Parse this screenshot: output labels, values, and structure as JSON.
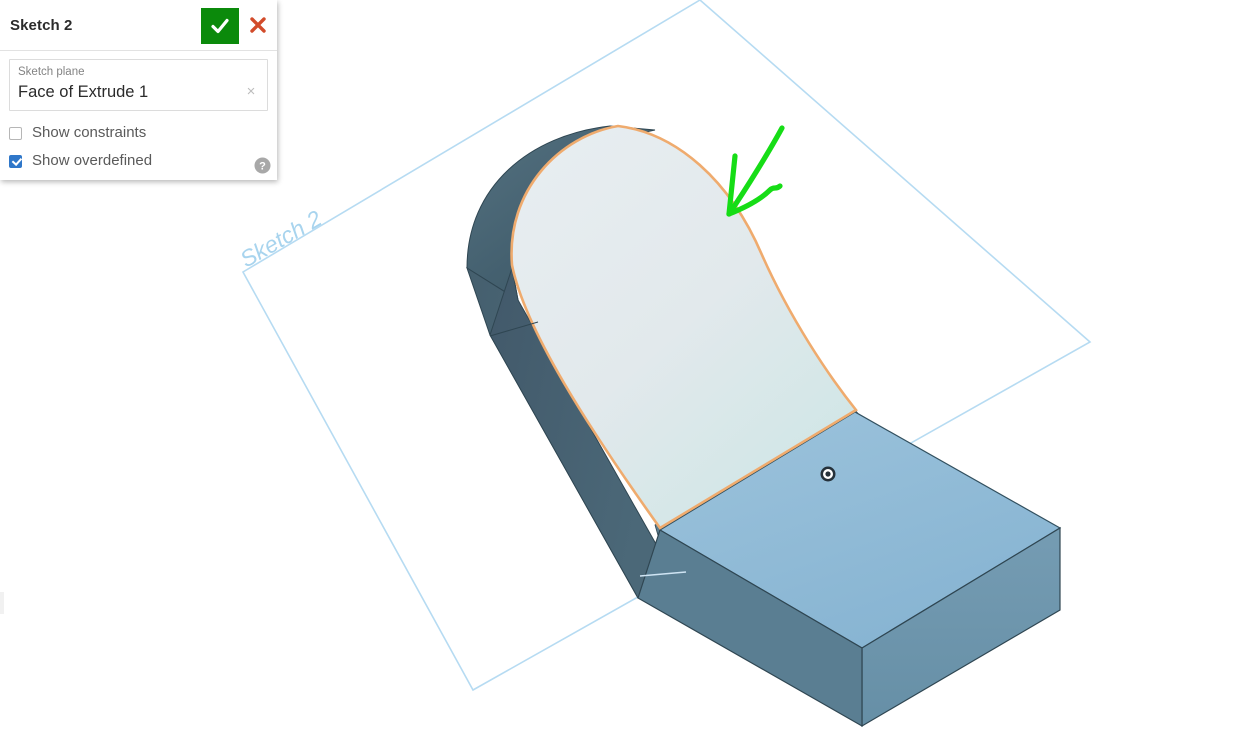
{
  "dialog": {
    "title": "Sketch 2",
    "accept_label": "accept",
    "cancel_label": "cancel",
    "field": {
      "label": "Sketch plane",
      "value": "Face of Extrude 1",
      "clear_glyph": "×"
    },
    "checkboxes": [
      {
        "label": "Show constraints",
        "checked": false
      },
      {
        "label": "Show overdefined",
        "checked": true
      }
    ],
    "help_label": "?"
  },
  "viewport": {
    "sketch_plane_label": "Sketch 2",
    "origin_marker": "origin-point"
  },
  "colors": {
    "accept_green": "#0b8a0b",
    "cancel_red": "#d24b2a",
    "checkbox_blue": "#2f77c9",
    "sketch_plane_blue": "#bcdcf0",
    "sketch_label_blue": "#a8d4ee",
    "selected_face": "#e2e9ec",
    "base_top_face": "#8fbad6",
    "base_side_face": "#6f97ae",
    "body_dark_face": "#4a6675",
    "highlight_orange": "#efab6e",
    "annotation_green": "#16dd16"
  }
}
